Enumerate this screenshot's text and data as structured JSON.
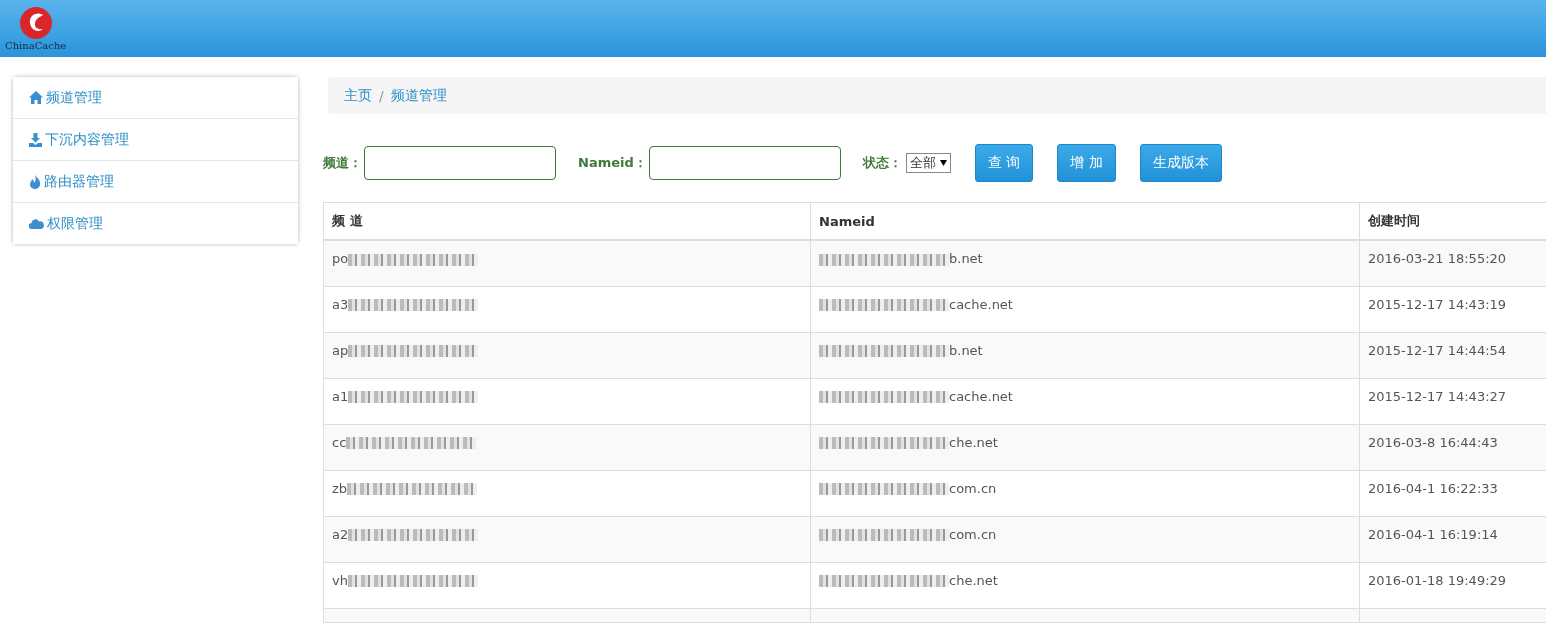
{
  "header": {
    "logo_text": "ChinaCache"
  },
  "sidebar": {
    "items": [
      {
        "label": "频道管理"
      },
      {
        "label": "下沉内容管理"
      },
      {
        "label": "路由器管理"
      },
      {
        "label": "权限管理"
      }
    ]
  },
  "breadcrumb": {
    "items": [
      "主页",
      "频道管理"
    ],
    "separator": "/"
  },
  "filters": {
    "channel_label": "频道：",
    "nameid_label": "Nameid：",
    "status_label": "状态：",
    "status_value": "全部"
  },
  "buttons": [
    "查 询",
    "增 加",
    "生成版本"
  ],
  "table": {
    "columns": [
      "频 道",
      "Nameid",
      "创建时间"
    ],
    "rows": [
      {
        "channel": "po",
        "nameid": "b.net",
        "created": "2016-03-21 18:55:20"
      },
      {
        "channel": "a3",
        "nameid": "cache.net",
        "created": "2015-12-17 14:43:19"
      },
      {
        "channel": "ap",
        "nameid": "b.net",
        "created": "2015-12-17 14:44:54"
      },
      {
        "channel": "a1",
        "nameid": "cache.net",
        "created": "2015-12-17 14:43:27"
      },
      {
        "channel": "cc",
        "nameid": "che.net",
        "created": "2016-03-8 16:44:43"
      },
      {
        "channel": "zb",
        "nameid": "com.cn",
        "created": "2016-04-1 16:22:33"
      },
      {
        "channel": "a2",
        "nameid": "com.cn",
        "created": "2016-04-1 16:19:14"
      },
      {
        "channel": "vh",
        "nameid": "che.net",
        "created": "2016-01-18 19:49:29"
      }
    ]
  }
}
